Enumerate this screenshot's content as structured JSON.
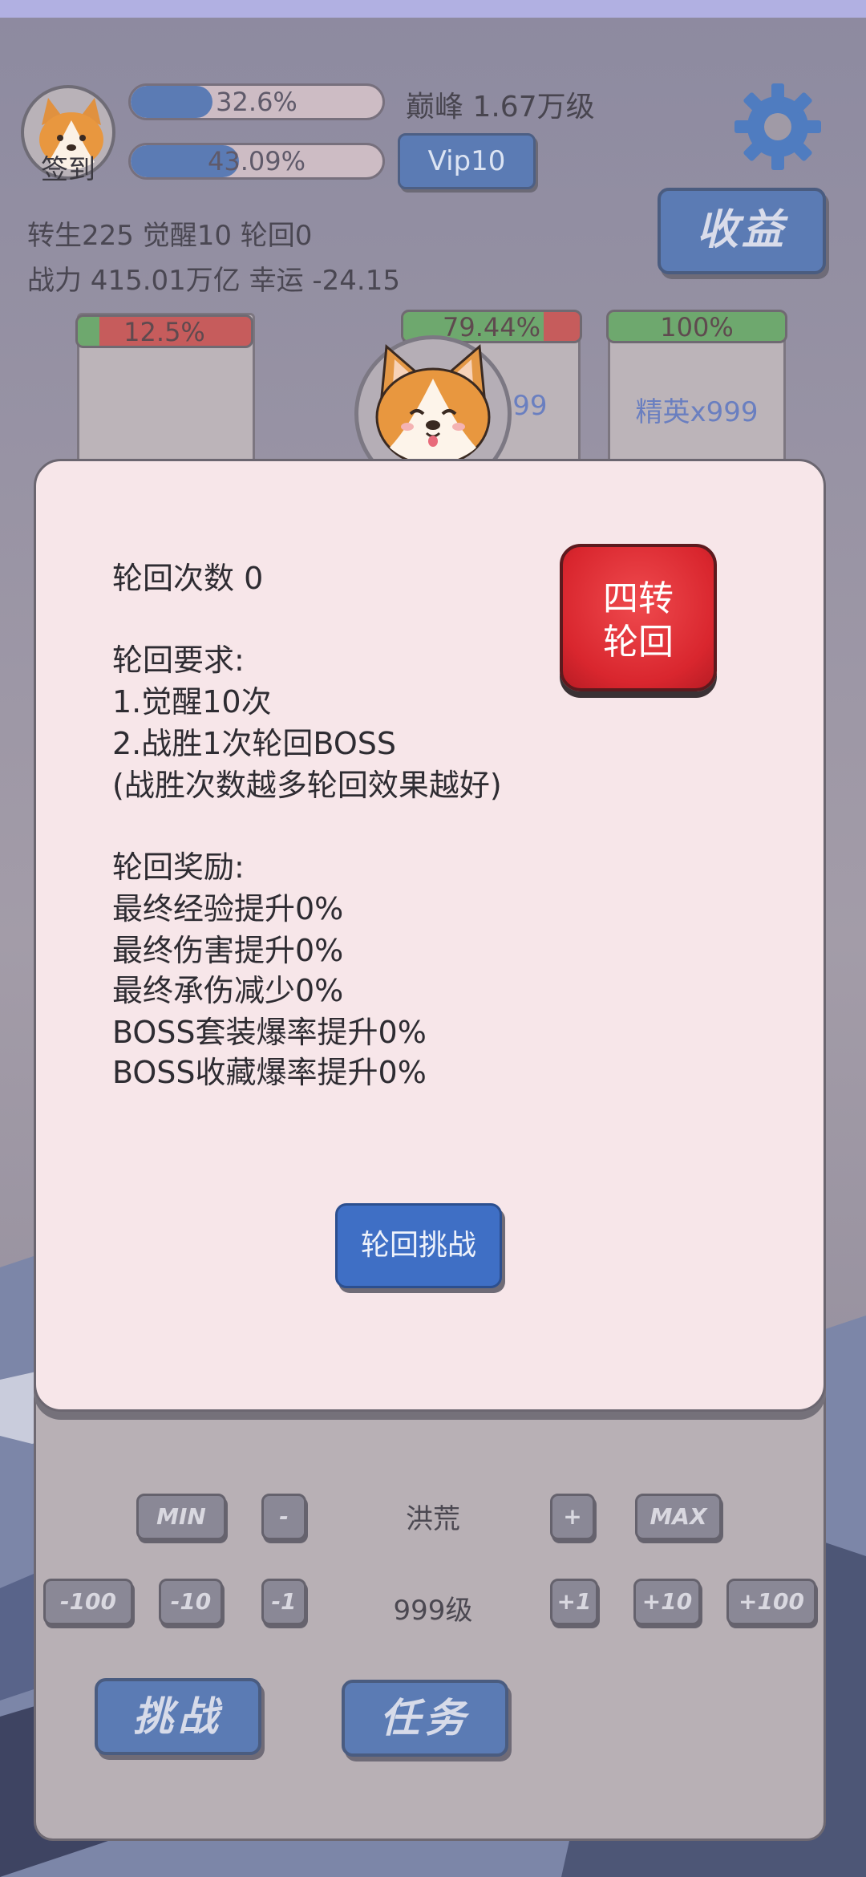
{
  "header": {
    "checkin_label": "签到",
    "exp_bar": {
      "percent_text": "32.6%",
      "fraction": 0.326
    },
    "second_bar": {
      "percent_text": "43.09%",
      "fraction": 0.4309
    },
    "peak_text": "巅峰 1.67万级",
    "vip_label": "Vip10",
    "income_label": "收益",
    "stats_line1": "转生225 觉醒10 轮回0",
    "stats_line2": "战力 415.01万亿  幸运 -24.15"
  },
  "cards": [
    {
      "hp_text": "12.5%",
      "hp_fraction": 0.125,
      "label": ""
    },
    {
      "hp_text": "79.44%",
      "hp_fraction": 0.7944,
      "label": "x999"
    },
    {
      "hp_text": "100%",
      "hp_fraction": 1.0,
      "label": "精英x999"
    }
  ],
  "dialog": {
    "count_line": "轮回次数 0",
    "req_title": "轮回要求:",
    "req_1": "1.觉醒10次",
    "req_2": "2.战胜1次轮回BOSS",
    "req_note": "(战胜次数越多轮回效果越好)",
    "reward_title": "轮回奖励:",
    "reward_1": "最终经验提升0%",
    "reward_2": "最终伤害提升0%",
    "reward_3": "最终承伤减少0%",
    "reward_4": "BOSS套装爆率提升0%",
    "reward_5": "BOSS收藏爆率提升0%",
    "reinc_btn_line1": "四转",
    "reinc_btn_line2": "轮回",
    "challenge_btn": "轮回挑战"
  },
  "panel": {
    "min_label": "MIN",
    "minus_label": "-",
    "zone_name": "洪荒",
    "plus_label": "+",
    "max_label": "MAX",
    "m100": "-100",
    "m10": "-10",
    "m1": "-1",
    "level_text": "999级",
    "p1": "+1",
    "p10": "+10",
    "p100": "+100",
    "challenge_label": "挑战",
    "task_label": "任务"
  },
  "colors": {
    "accent_blue": "#5b7bb4",
    "dialog_bg": "#f7e6e9",
    "reinc_red": "#d9262e"
  }
}
